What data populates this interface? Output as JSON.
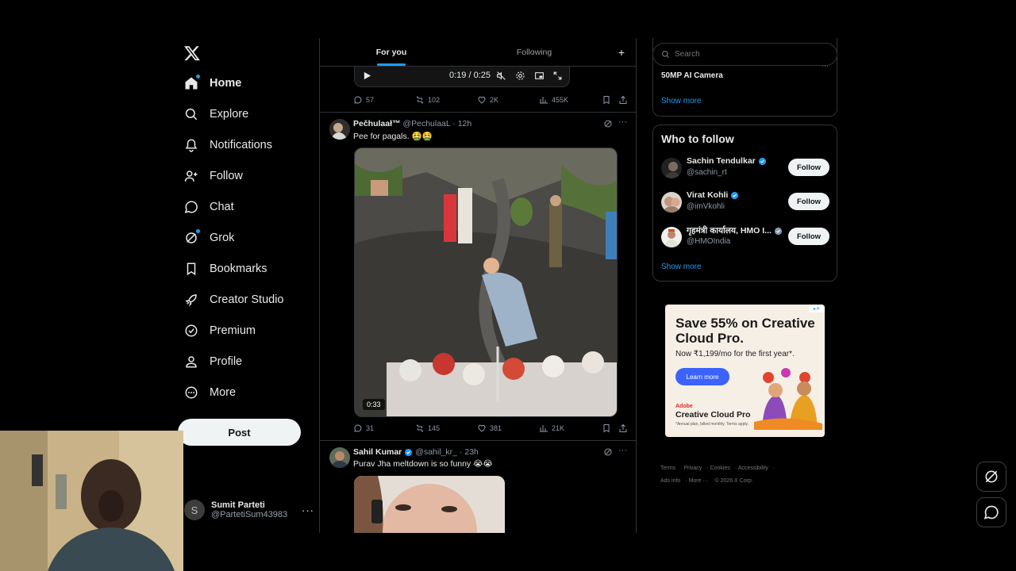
{
  "nav": {
    "items": [
      {
        "label": "Home",
        "icon": "home-icon"
      },
      {
        "label": "Explore",
        "icon": "search-icon"
      },
      {
        "label": "Notifications",
        "icon": "bell-icon"
      },
      {
        "label": "Follow",
        "icon": "person-add-icon"
      },
      {
        "label": "Chat",
        "icon": "chat-icon"
      },
      {
        "label": "Grok",
        "icon": "grok-icon"
      },
      {
        "label": "Bookmarks",
        "icon": "bookmark-icon"
      },
      {
        "label": "Creator Studio",
        "icon": "rocket-icon"
      },
      {
        "label": "Premium",
        "icon": "verified-icon"
      },
      {
        "label": "Profile",
        "icon": "person-icon"
      },
      {
        "label": "More",
        "icon": "more-circle-icon"
      }
    ],
    "post_label": "Post"
  },
  "account": {
    "initial": "S",
    "name": "Sumit Parteti",
    "handle": "@PartetiSum43983"
  },
  "tabs": {
    "for_you": "For you",
    "following": "Following"
  },
  "prev_tweet": {
    "video_time": "0:19 / 0:25",
    "replies": "57",
    "reposts": "102",
    "likes": "2K",
    "views": "455K"
  },
  "tweet1": {
    "name": "Pečhulaał™",
    "handle": "@PechulaaL",
    "time": "· 12h",
    "text": "Pee for pagals. 🤮🤮",
    "duration": "0:33",
    "replies": "31",
    "reposts": "145",
    "likes": "381",
    "views": "21K"
  },
  "tweet2": {
    "name": "Sahil Kumar",
    "handle": "@sahil_kr_",
    "time": "· 23h",
    "text": "Purav Jha meltdown is so funny 😭😭"
  },
  "right": {
    "search_placeholder": "Search",
    "trend_title": "50MP AI Camera",
    "trend_show_more": "Show more",
    "wtf_title": "Who to follow",
    "wtf": [
      {
        "name": "Sachin Tendulkar",
        "handle": "@sachin_rt",
        "button": "Follow"
      },
      {
        "name": "Virat Kohli",
        "handle": "@imVkohli",
        "button": "Follow"
      },
      {
        "name": "गृहमंत्री कार्यालय, HMO I...",
        "handle": "@HMOIndia",
        "button": "Follow"
      }
    ],
    "wtf_show_more": "Show more"
  },
  "ad": {
    "title": "Save 55% on Creative Cloud Pro.",
    "subtitle": "Now ₹1,199/mo for the first year*.",
    "cta": "Learn more",
    "brand_top": "Adobe",
    "brand": "Creative Cloud Pro",
    "fine": "*Annual plan, billed monthly. Terms apply."
  },
  "footer": {
    "links": [
      "Terms",
      "Privacy",
      "Cookies",
      "Accessibility",
      "Ads info",
      "More ···"
    ],
    "copyright": "© 2026 X Corp."
  },
  "colors": {
    "accent": "#1d9bf0",
    "background": "#000000",
    "border": "#2f3336",
    "muted": "#8b98a5"
  }
}
